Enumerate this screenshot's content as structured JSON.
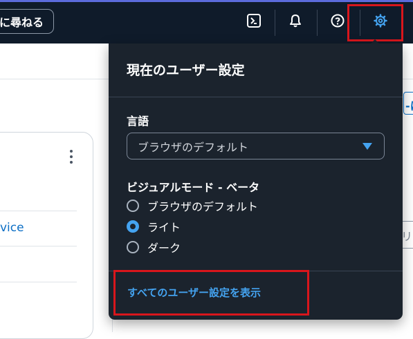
{
  "header": {
    "ask_button_label": "に尋ねる",
    "icons": [
      "terminal-icon",
      "bell-icon",
      "help-icon",
      "gear-icon"
    ]
  },
  "background": {
    "service_link_partial": "vice",
    "right_link_partial": "-に",
    "right_input_partial": "リ"
  },
  "settings_panel": {
    "title": "現在のユーザー設定",
    "language": {
      "label": "言語",
      "selected": "ブラウザのデフォルト"
    },
    "visual_mode": {
      "label": "ビジュアルモード - ベータ",
      "options": [
        {
          "label": "ブラウザのデフォルト",
          "checked": false
        },
        {
          "label": "ライト",
          "checked": true
        },
        {
          "label": "ダーク",
          "checked": false
        }
      ]
    },
    "all_settings_link": "すべてのユーザー設定を表示"
  },
  "colors": {
    "header_bg": "#0f1b2a",
    "panel_bg": "#1b232d",
    "accent_blue": "#44a3f0",
    "highlight_red": "#d9161c",
    "link_blue": "#0b6ec5"
  }
}
